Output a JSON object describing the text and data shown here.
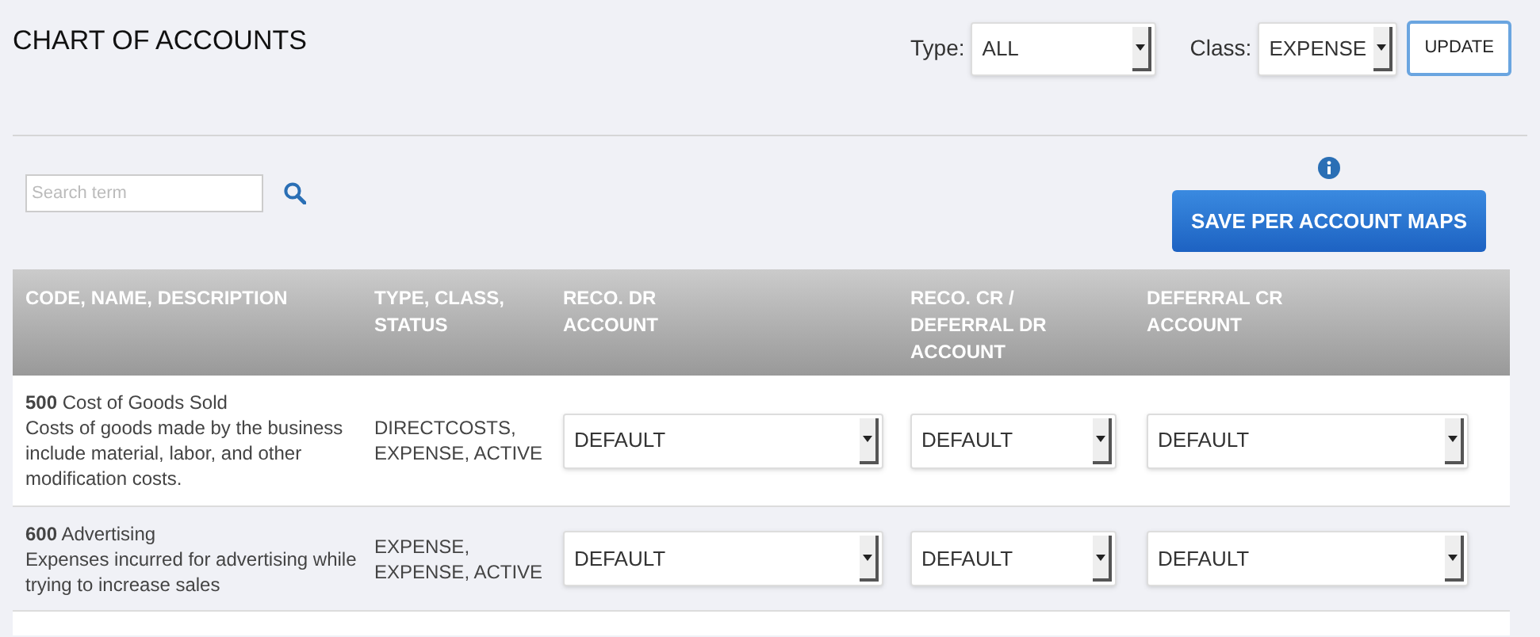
{
  "title": "CHART OF ACCOUNTS",
  "filters": [
    {
      "label": "Type:",
      "value": "ALL"
    },
    {
      "label": "Class:",
      "value": "EXPENSE"
    }
  ],
  "update_button": "UPDATE",
  "search": {
    "placeholder": "Search term"
  },
  "save_button": "SAVE PER ACCOUNT MAPS",
  "table": {
    "columns": [
      "CODE, NAME, DESCRIPTION",
      "TYPE, CLASS, STATUS",
      "RECO. DR ACCOUNT",
      "RECO. CR / DEFERRAL DR ACCOUNT",
      "DEFERRAL CR ACCOUNT"
    ],
    "rows": [
      {
        "code": "500",
        "name": "Cost of Goods Sold",
        "description": "Costs of goods made by the business include material, labor, and other modification costs.",
        "type_class_status": "DIRECTCOSTS, EXPENSE, ACTIVE",
        "reco_dr": "DEFAULT",
        "reco_cr": "DEFAULT",
        "deferral_cr": "DEFAULT"
      },
      {
        "code": "600",
        "name": "Advertising",
        "description": "Expenses incurred for advertising while trying to increase sales",
        "type_class_status": "EXPENSE, EXPENSE, ACTIVE",
        "reco_dr": "DEFAULT",
        "reco_cr": "DEFAULT",
        "deferral_cr": "DEFAULT"
      }
    ]
  }
}
